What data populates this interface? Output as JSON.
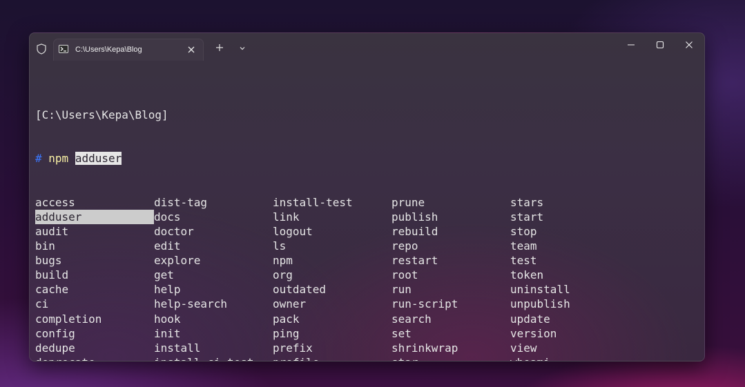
{
  "tab": {
    "title": "C:\\Users\\Kepa\\Blog",
    "icon": "powershell-icon"
  },
  "titlebar": {
    "shield_icon": "shield-icon",
    "new_tab_icon": "plus-icon",
    "dropdown_icon": "chevron-down-icon",
    "minimize_icon": "minimize-icon",
    "maximize_icon": "maximize-icon",
    "close_icon": "close-icon"
  },
  "terminal": {
    "cwd_line": "[C:\\Users\\Kepa\\Blog]",
    "prompt_symbol": "#",
    "command": "npm",
    "argument": "adduser",
    "completions": [
      [
        "access",
        "dist-tag",
        "install-test",
        "prune",
        "stars"
      ],
      [
        "adduser",
        "docs",
        "link",
        "publish",
        "start"
      ],
      [
        "audit",
        "doctor",
        "logout",
        "rebuild",
        "stop"
      ],
      [
        "bin",
        "edit",
        "ls",
        "repo",
        "team"
      ],
      [
        "bugs",
        "explore",
        "npm",
        "restart",
        "test"
      ],
      [
        "build",
        "get",
        "org",
        "root",
        "token"
      ],
      [
        "cache",
        "help",
        "outdated",
        "run",
        "uninstall"
      ],
      [
        "ci",
        "help-search",
        "owner",
        "run-script",
        "unpublish"
      ],
      [
        "completion",
        "hook",
        "pack",
        "search",
        "update"
      ],
      [
        "config",
        "init",
        "ping",
        "set",
        "version"
      ],
      [
        "dedupe",
        "install",
        "prefix",
        "shrinkwrap",
        "view"
      ],
      [
        "deprecate",
        "install-ci-test",
        "profile",
        "star",
        "whoami"
      ]
    ],
    "selected": "adduser"
  },
  "colors": {
    "prompt_hash": "#3b78ff",
    "command": "#f9f1a5",
    "text": "#e6e6e6",
    "selection": "#cccccc"
  }
}
